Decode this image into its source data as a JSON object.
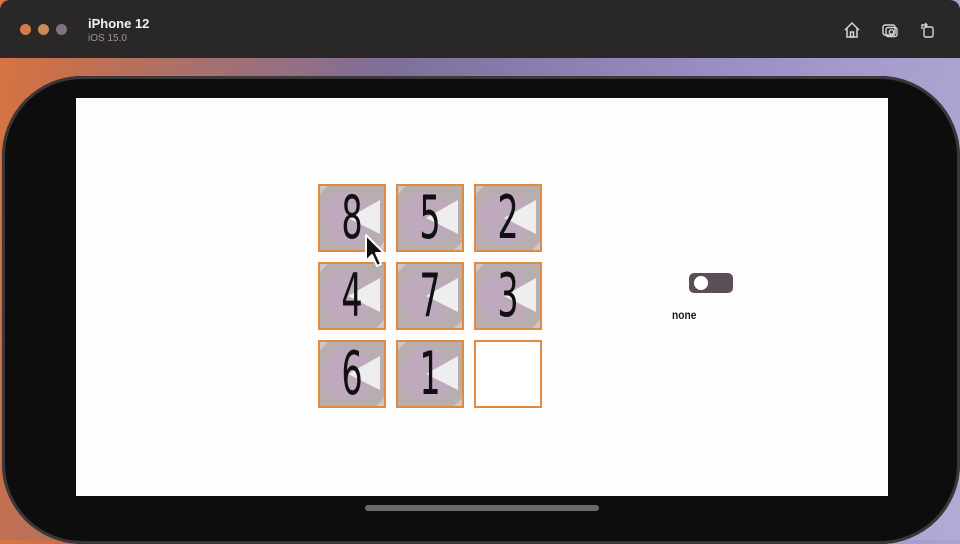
{
  "window": {
    "device_name": "iPhone 12",
    "os_version": "iOS 15.0",
    "toolbar_icons": [
      "home-icon",
      "screenshot-icon",
      "rotate-icon"
    ]
  },
  "puzzle": {
    "tiles": [
      "8",
      "5",
      "2",
      "4",
      "7",
      "3",
      "6",
      "1",
      ""
    ],
    "empty_index": 8,
    "tile_border_color": "#e0893f"
  },
  "toggle": {
    "on": false,
    "label": "none"
  },
  "colors": {
    "accent": "#e0893f",
    "toggle_track": "#5a4f58"
  }
}
